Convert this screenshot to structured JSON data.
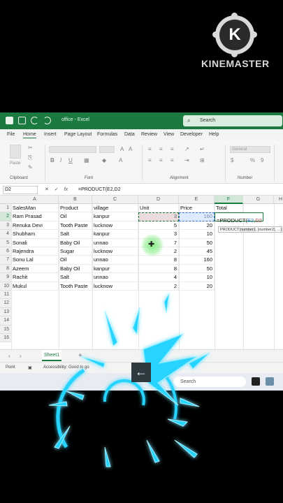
{
  "watermark": {
    "brand": "KINEMASTER",
    "logo_letter": "K"
  },
  "titlebar": {
    "doc_title": "office - Excel",
    "search_label": "Search"
  },
  "menu": [
    "File",
    "Home",
    "Insert",
    "Page Layout",
    "Formulas",
    "Data",
    "Review",
    "View",
    "Developer",
    "Help"
  ],
  "ribbon": {
    "groups": [
      "Clipboard",
      "Font",
      "Alignment",
      "Number"
    ],
    "paste_label": "Paste",
    "number_format": "General",
    "percent_symbol": "%"
  },
  "formula_bar": {
    "name_box": "D2",
    "formula": "=PRODUCT(E2,D2"
  },
  "columns": [
    "A",
    "B",
    "C",
    "D",
    "E",
    "F",
    "G",
    "H"
  ],
  "rows": [
    "1",
    "2",
    "3",
    "4",
    "5",
    "6",
    "7",
    "8",
    "9",
    "10",
    "11",
    "12",
    "13",
    "14",
    "15",
    "16"
  ],
  "table": {
    "headers": [
      "SalesMan",
      "Product",
      "village",
      "Unit",
      "Price",
      "Total"
    ],
    "rows": [
      [
        "Ram Prasad",
        "Oil",
        "kanpur",
        "3",
        "160"
      ],
      [
        "Renuka Devi",
        "Tooth Paste",
        "lucknow",
        "5",
        "20"
      ],
      [
        "Shubham",
        "Salt",
        "kanpur",
        "3",
        "10"
      ],
      [
        "Sonali",
        "Baby Oil",
        "unnao",
        "7",
        "50"
      ],
      [
        "Rajendra",
        "Sugar",
        "lucknow",
        "2",
        "45"
      ],
      [
        "Sonu Lal",
        "Oil",
        "unnao",
        "8",
        "160"
      ],
      [
        "Azeem",
        "Baby Oil",
        "kanpur",
        "8",
        "50"
      ],
      [
        "Rachit",
        "Salt",
        "unnao",
        "4",
        "10"
      ],
      [
        "Mukul",
        "Tooth Paste",
        "lucknow",
        "2",
        "20"
      ]
    ]
  },
  "editing_cell": {
    "prefix": "=PRODUCT(",
    "e_ref": "E2",
    "comma": ",",
    "d_ref": "D2"
  },
  "tooltip": {
    "func": "PRODUCT(",
    "arg1": "number1",
    "rest": ", [number2], ...)"
  },
  "sheet_tab": "Sheet1",
  "status": {
    "mode": "Point",
    "accessibility": "Accessibility: Good to go"
  },
  "taskbar": {
    "search": "Search"
  },
  "back_button": "←",
  "colors": {
    "excel_green": "#1a7a3f",
    "spark": "#27d4ff"
  }
}
